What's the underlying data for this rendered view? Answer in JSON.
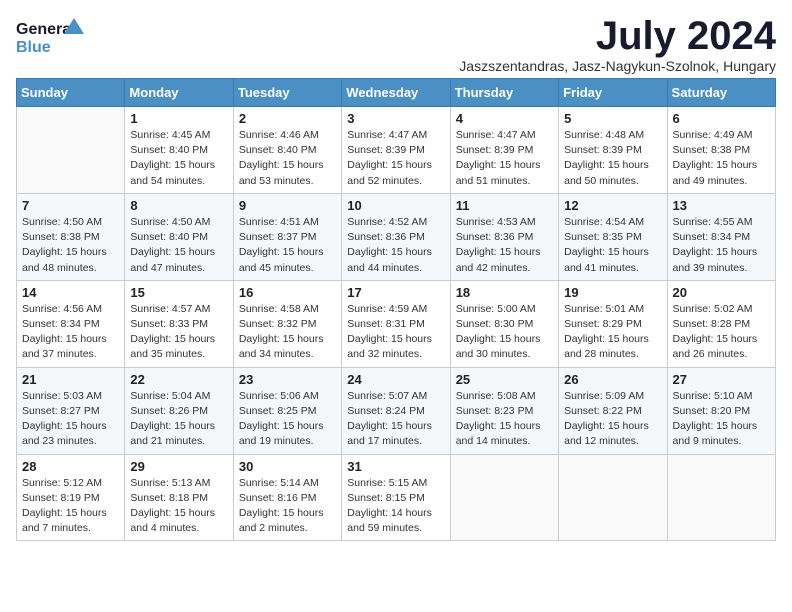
{
  "logo": {
    "line1": "General",
    "line2": "Blue"
  },
  "title": "July 2024",
  "location": "Jaszszentandras, Jasz-Nagykun-Szolnok, Hungary",
  "days_of_week": [
    "Sunday",
    "Monday",
    "Tuesday",
    "Wednesday",
    "Thursday",
    "Friday",
    "Saturday"
  ],
  "weeks": [
    [
      {
        "num": "",
        "sunrise": "",
        "sunset": "",
        "daylight": ""
      },
      {
        "num": "1",
        "sunrise": "Sunrise: 4:45 AM",
        "sunset": "Sunset: 8:40 PM",
        "daylight": "Daylight: 15 hours and 54 minutes."
      },
      {
        "num": "2",
        "sunrise": "Sunrise: 4:46 AM",
        "sunset": "Sunset: 8:40 PM",
        "daylight": "Daylight: 15 hours and 53 minutes."
      },
      {
        "num": "3",
        "sunrise": "Sunrise: 4:47 AM",
        "sunset": "Sunset: 8:39 PM",
        "daylight": "Daylight: 15 hours and 52 minutes."
      },
      {
        "num": "4",
        "sunrise": "Sunrise: 4:47 AM",
        "sunset": "Sunset: 8:39 PM",
        "daylight": "Daylight: 15 hours and 51 minutes."
      },
      {
        "num": "5",
        "sunrise": "Sunrise: 4:48 AM",
        "sunset": "Sunset: 8:39 PM",
        "daylight": "Daylight: 15 hours and 50 minutes."
      },
      {
        "num": "6",
        "sunrise": "Sunrise: 4:49 AM",
        "sunset": "Sunset: 8:38 PM",
        "daylight": "Daylight: 15 hours and 49 minutes."
      }
    ],
    [
      {
        "num": "7",
        "sunrise": "Sunrise: 4:50 AM",
        "sunset": "Sunset: 8:38 PM",
        "daylight": "Daylight: 15 hours and 48 minutes."
      },
      {
        "num": "8",
        "sunrise": "Sunrise: 4:50 AM",
        "sunset": "Sunset: 8:40 PM",
        "daylight": "Daylight: 15 hours and 47 minutes."
      },
      {
        "num": "9",
        "sunrise": "Sunrise: 4:51 AM",
        "sunset": "Sunset: 8:37 PM",
        "daylight": "Daylight: 15 hours and 45 minutes."
      },
      {
        "num": "10",
        "sunrise": "Sunrise: 4:52 AM",
        "sunset": "Sunset: 8:36 PM",
        "daylight": "Daylight: 15 hours and 44 minutes."
      },
      {
        "num": "11",
        "sunrise": "Sunrise: 4:53 AM",
        "sunset": "Sunset: 8:36 PM",
        "daylight": "Daylight: 15 hours and 42 minutes."
      },
      {
        "num": "12",
        "sunrise": "Sunrise: 4:54 AM",
        "sunset": "Sunset: 8:35 PM",
        "daylight": "Daylight: 15 hours and 41 minutes."
      },
      {
        "num": "13",
        "sunrise": "Sunrise: 4:55 AM",
        "sunset": "Sunset: 8:34 PM",
        "daylight": "Daylight: 15 hours and 39 minutes."
      }
    ],
    [
      {
        "num": "14",
        "sunrise": "Sunrise: 4:56 AM",
        "sunset": "Sunset: 8:34 PM",
        "daylight": "Daylight: 15 hours and 37 minutes."
      },
      {
        "num": "15",
        "sunrise": "Sunrise: 4:57 AM",
        "sunset": "Sunset: 8:33 PM",
        "daylight": "Daylight: 15 hours and 35 minutes."
      },
      {
        "num": "16",
        "sunrise": "Sunrise: 4:58 AM",
        "sunset": "Sunset: 8:32 PM",
        "daylight": "Daylight: 15 hours and 34 minutes."
      },
      {
        "num": "17",
        "sunrise": "Sunrise: 4:59 AM",
        "sunset": "Sunset: 8:31 PM",
        "daylight": "Daylight: 15 hours and 32 minutes."
      },
      {
        "num": "18",
        "sunrise": "Sunrise: 5:00 AM",
        "sunset": "Sunset: 8:30 PM",
        "daylight": "Daylight: 15 hours and 30 minutes."
      },
      {
        "num": "19",
        "sunrise": "Sunrise: 5:01 AM",
        "sunset": "Sunset: 8:29 PM",
        "daylight": "Daylight: 15 hours and 28 minutes."
      },
      {
        "num": "20",
        "sunrise": "Sunrise: 5:02 AM",
        "sunset": "Sunset: 8:28 PM",
        "daylight": "Daylight: 15 hours and 26 minutes."
      }
    ],
    [
      {
        "num": "21",
        "sunrise": "Sunrise: 5:03 AM",
        "sunset": "Sunset: 8:27 PM",
        "daylight": "Daylight: 15 hours and 23 minutes."
      },
      {
        "num": "22",
        "sunrise": "Sunrise: 5:04 AM",
        "sunset": "Sunset: 8:26 PM",
        "daylight": "Daylight: 15 hours and 21 minutes."
      },
      {
        "num": "23",
        "sunrise": "Sunrise: 5:06 AM",
        "sunset": "Sunset: 8:25 PM",
        "daylight": "Daylight: 15 hours and 19 minutes."
      },
      {
        "num": "24",
        "sunrise": "Sunrise: 5:07 AM",
        "sunset": "Sunset: 8:24 PM",
        "daylight": "Daylight: 15 hours and 17 minutes."
      },
      {
        "num": "25",
        "sunrise": "Sunrise: 5:08 AM",
        "sunset": "Sunset: 8:23 PM",
        "daylight": "Daylight: 15 hours and 14 minutes."
      },
      {
        "num": "26",
        "sunrise": "Sunrise: 5:09 AM",
        "sunset": "Sunset: 8:22 PM",
        "daylight": "Daylight: 15 hours and 12 minutes."
      },
      {
        "num": "27",
        "sunrise": "Sunrise: 5:10 AM",
        "sunset": "Sunset: 8:20 PM",
        "daylight": "Daylight: 15 hours and 9 minutes."
      }
    ],
    [
      {
        "num": "28",
        "sunrise": "Sunrise: 5:12 AM",
        "sunset": "Sunset: 8:19 PM",
        "daylight": "Daylight: 15 hours and 7 minutes."
      },
      {
        "num": "29",
        "sunrise": "Sunrise: 5:13 AM",
        "sunset": "Sunset: 8:18 PM",
        "daylight": "Daylight: 15 hours and 4 minutes."
      },
      {
        "num": "30",
        "sunrise": "Sunrise: 5:14 AM",
        "sunset": "Sunset: 8:16 PM",
        "daylight": "Daylight: 15 hours and 2 minutes."
      },
      {
        "num": "31",
        "sunrise": "Sunrise: 5:15 AM",
        "sunset": "Sunset: 8:15 PM",
        "daylight": "Daylight: 14 hours and 59 minutes."
      },
      {
        "num": "",
        "sunrise": "",
        "sunset": "",
        "daylight": ""
      },
      {
        "num": "",
        "sunrise": "",
        "sunset": "",
        "daylight": ""
      },
      {
        "num": "",
        "sunrise": "",
        "sunset": "",
        "daylight": ""
      }
    ]
  ]
}
